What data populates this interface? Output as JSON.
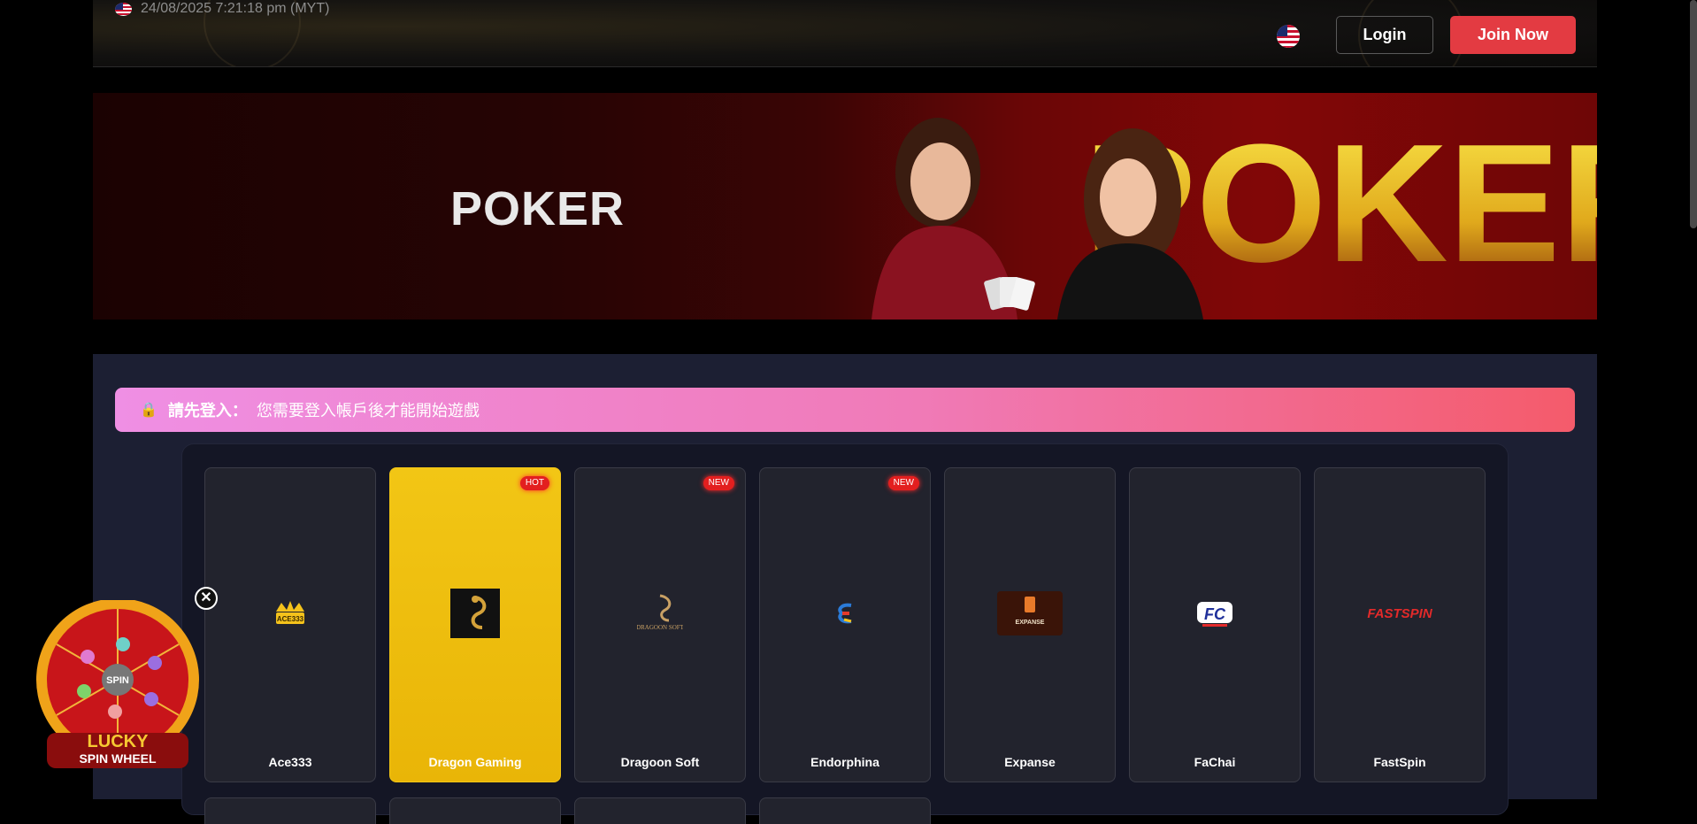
{
  "header": {
    "datetime": "24/08/2025 7:21:18 pm (MYT)",
    "login_label": "Login",
    "join_label": "Join Now",
    "language_flag": "us-flag-icon"
  },
  "banner": {
    "title": "POKER",
    "art_text": "POKER"
  },
  "notice": {
    "icon": "lock-icon",
    "label": "請先登入：",
    "message": "您需要登入帳戶後才能開始遊戲"
  },
  "providers": [
    {
      "name": "Ace333",
      "badge": "",
      "active": false,
      "logo_text": "ACE333"
    },
    {
      "name": "Dragon Gaming",
      "badge": "HOT",
      "active": true,
      "logo_text": ""
    },
    {
      "name": "Dragoon Soft",
      "badge": "NEW",
      "active": false,
      "logo_text": "DRAGOON SOFT"
    },
    {
      "name": "Endorphina",
      "badge": "NEW",
      "active": false,
      "logo_text": ""
    },
    {
      "name": "Expanse",
      "badge": "",
      "active": false,
      "logo_text": "EXPANSE"
    },
    {
      "name": "FaChai",
      "badge": "",
      "active": false,
      "logo_text": "FC"
    },
    {
      "name": "FastSpin",
      "badge": "",
      "active": false,
      "logo_text": "FASTSPIN"
    }
  ],
  "spin_wheel": {
    "center_label": "SPIN",
    "title_line1": "LUCKY",
    "title_line2": "SPIN WHEEL",
    "close_label": "✕"
  },
  "colors": {
    "join_button": "#e33b42",
    "active_card": "#f2c615",
    "badge": "#e31f1f",
    "content_bg": "#1c1f33"
  }
}
